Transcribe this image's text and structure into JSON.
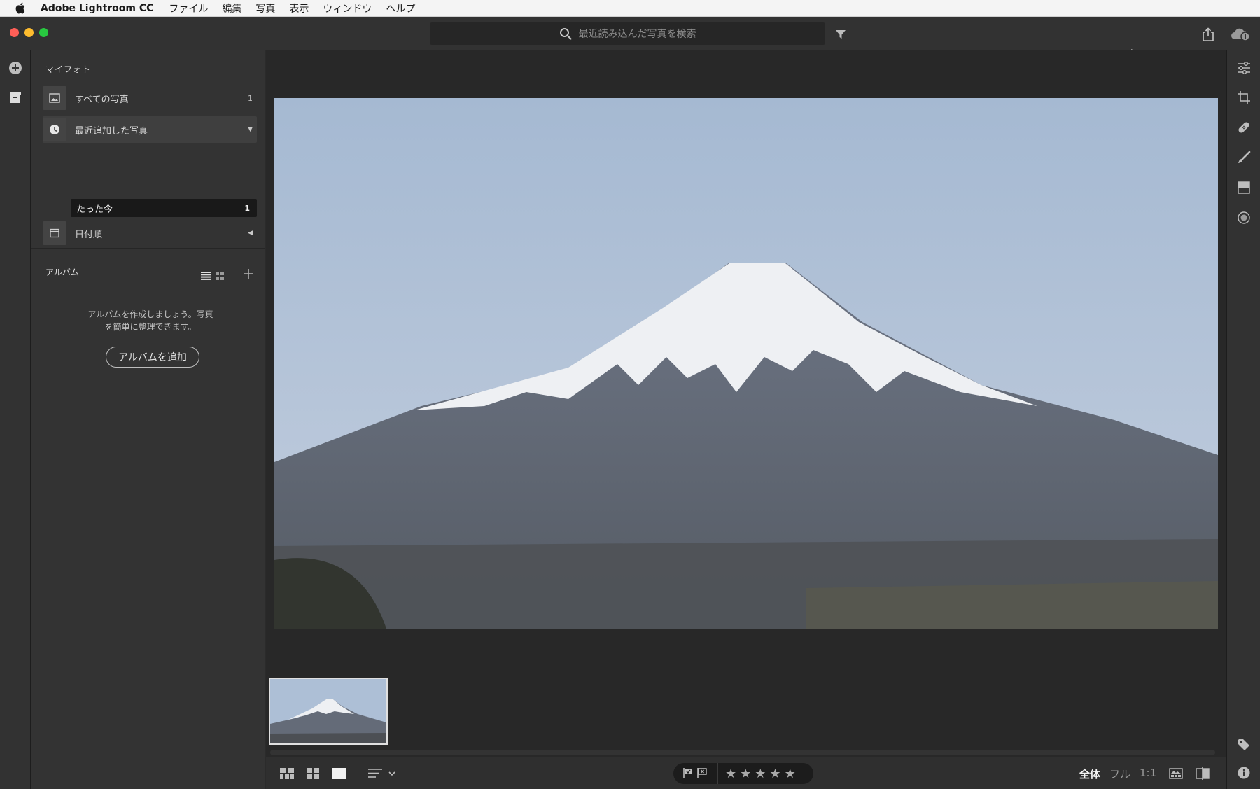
{
  "menubar": {
    "app_name": "Adobe Lightroom CC",
    "menus": [
      "ファイル",
      "編集",
      "写真",
      "表示",
      "ウィンドウ",
      "ヘルプ"
    ]
  },
  "titlebar": {
    "search_placeholder": "最近読み込んだ写真を検索"
  },
  "left_panel": {
    "my_photos_title": "マイフォト",
    "items": [
      {
        "label": "すべての写真",
        "count": "1",
        "icon": "image-icon"
      },
      {
        "label": "最近追加した写真",
        "icon": "clock-icon",
        "expanded": true
      },
      {
        "label": "日付順",
        "icon": "calendar-icon",
        "expanded": false
      }
    ],
    "sub_item": {
      "label": "たった今",
      "count": "1"
    },
    "albums_title": "アルバム",
    "albums_hint_line1": "アルバムを作成しましょう。写真",
    "albums_hint_line2": "を簡単に整理できます。",
    "add_album_label": "アルバムを追加"
  },
  "bottombar": {
    "stars": [
      "★",
      "★",
      "★",
      "★",
      "★"
    ],
    "zoom_fit": "全体",
    "zoom_fill": "フル",
    "zoom_1to1": "1:1"
  },
  "colors": {
    "accent_red": "#fe5f57",
    "accent_yellow": "#febc2e",
    "accent_green": "#28c840",
    "panel_bg": "#333333",
    "main_bg": "#282828"
  }
}
